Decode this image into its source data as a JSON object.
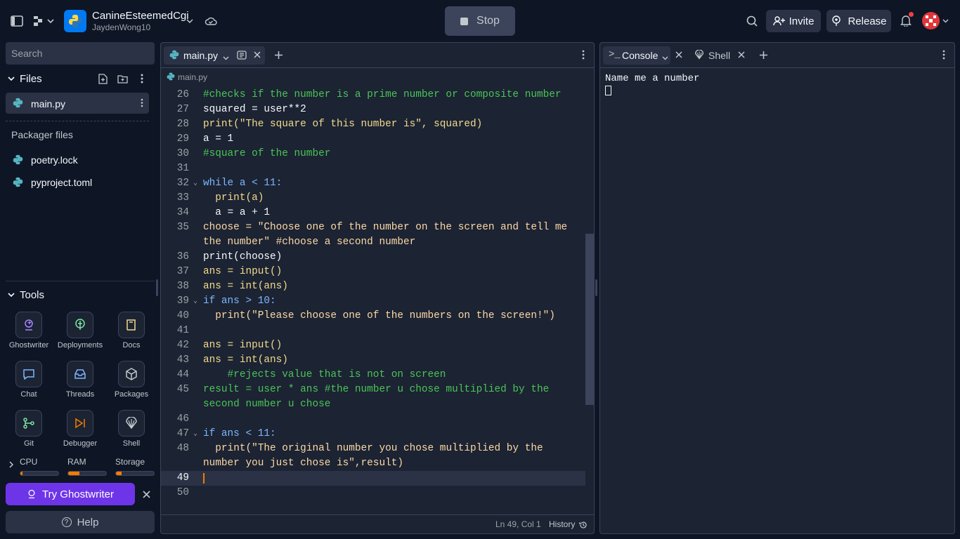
{
  "repl": {
    "name": "CanineEsteemedCgi",
    "owner": "JaydenWong10"
  },
  "header": {
    "stop_label": "Stop",
    "invite_label": "Invite",
    "release_label": "Release"
  },
  "sidebar": {
    "search_placeholder": "Search",
    "files_title": "Files",
    "files": [
      "main.py"
    ],
    "packager_title": "Packager files",
    "packager_files": [
      "poetry.lock",
      "pyproject.toml"
    ],
    "tools_title": "Tools",
    "tools": [
      "Ghostwriter",
      "Deployments",
      "Docs",
      "Chat",
      "Threads",
      "Packages",
      "Git",
      "Debugger",
      "Shell"
    ],
    "resources": {
      "cpu_label": "CPU",
      "ram_label": "RAM",
      "storage_label": "Storage",
      "cpu": 0.05,
      "ram": 0.3,
      "storage": 0.15
    },
    "try_ghostwriter": "Try Ghostwriter",
    "help": "Help"
  },
  "editor": {
    "tab": "main.py",
    "breadcrumb": "main.py",
    "status": "Ln 49, Col 1",
    "history": "History",
    "lines": [
      {
        "num": "26",
        "text": "#checks if the number is a prime number or composite number"
      },
      {
        "num": "27",
        "text": "squared = user**2"
      },
      {
        "num": "28",
        "text": "print(\"The square of this number is\", squared)"
      },
      {
        "num": "29",
        "text": "a = 1"
      },
      {
        "num": "30",
        "text": "#square of the number"
      },
      {
        "num": "31",
        "text": ""
      },
      {
        "num": "32",
        "text": "while a < 11:"
      },
      {
        "num": "33",
        "text": "  print(a)"
      },
      {
        "num": "34",
        "text": "  a = a + 1"
      },
      {
        "num": "35",
        "text": "choose = \"Choose one of the number on the screen and tell me the number\" #choose a second number"
      },
      {
        "num": "36",
        "text": "print(choose)"
      },
      {
        "num": "37",
        "text": "ans = input()"
      },
      {
        "num": "38",
        "text": "ans = int(ans)"
      },
      {
        "num": "39",
        "text": "if ans > 10:"
      },
      {
        "num": "40",
        "text": "  print(\"Please choose one of the numbers on the screen!\")"
      },
      {
        "num": "41",
        "text": ""
      },
      {
        "num": "42",
        "text": "ans = input()"
      },
      {
        "num": "43",
        "text": "ans = int(ans)"
      },
      {
        "num": "44",
        "text": "    #rejects value that is not on screen"
      },
      {
        "num": "45",
        "text": "result = user * ans #the number u chose multiplied by the second number u chose"
      },
      {
        "num": "46",
        "text": ""
      },
      {
        "num": "47",
        "text": "if ans < 11:"
      },
      {
        "num": "48",
        "text": "  print(\"The original number you chose multiplied by the number you just chose is\",result)"
      },
      {
        "num": "49",
        "text": ""
      },
      {
        "num": "50",
        "text": ""
      }
    ]
  },
  "console": {
    "tab_console": "Console",
    "tab_shell": "Shell",
    "output": "Name me a number"
  }
}
